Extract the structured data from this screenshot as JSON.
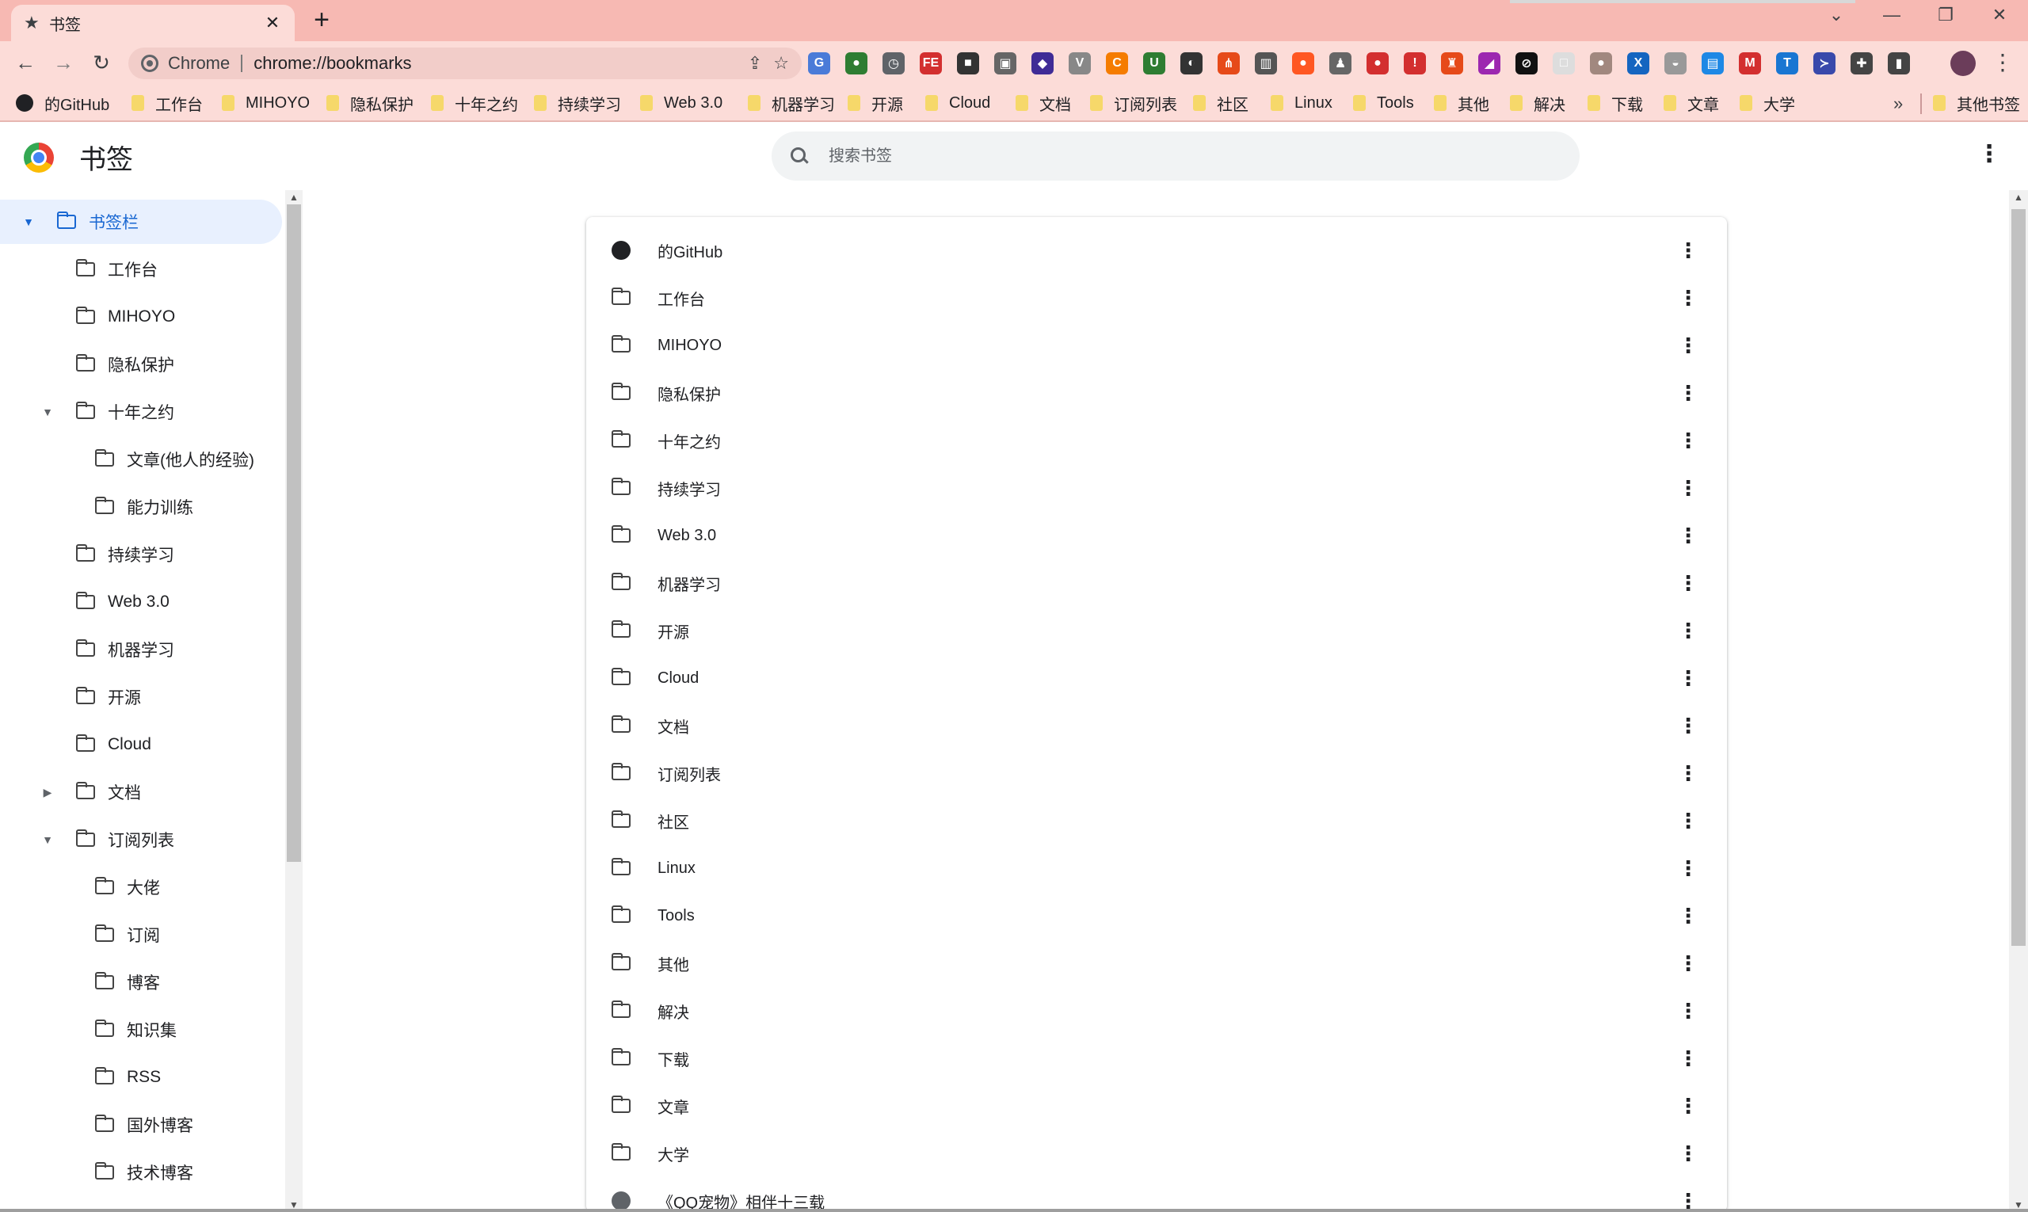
{
  "tab": {
    "title": "书签"
  },
  "omnibox": {
    "chrome_label": "Chrome",
    "url": "chrome://bookmarks"
  },
  "extensions": [
    {
      "name": "translate-ext-icon",
      "glyph": "G",
      "color": "#4a7bd8"
    },
    {
      "name": "globe-ext-icon",
      "glyph": "●",
      "color": "#2e7d32"
    },
    {
      "name": "clock-ext-icon",
      "glyph": "◷",
      "color": "#5f6368"
    },
    {
      "name": "fe-ext-icon",
      "glyph": "FE",
      "color": "#d32f2f"
    },
    {
      "name": "cube-ext-icon",
      "glyph": "■",
      "color": "#333333"
    },
    {
      "name": "gamepad-ext-icon",
      "glyph": "▣",
      "color": "#666666"
    },
    {
      "name": "diamond-ext-icon",
      "glyph": "◆",
      "color": "#3f2b96"
    },
    {
      "name": "vue-ext-icon",
      "glyph": "V",
      "color": "#888888"
    },
    {
      "name": "orange-ext-icon",
      "glyph": "C",
      "color": "#f57c00"
    },
    {
      "name": "ublock-ext-icon",
      "glyph": "U",
      "color": "#2e7d32"
    },
    {
      "name": "dark-ext-icon",
      "glyph": "◐",
      "color": "#333333"
    },
    {
      "name": "tree-ext-icon",
      "glyph": "⋔",
      "color": "#e64a19"
    },
    {
      "name": "museum-ext-icon",
      "glyph": "▥",
      "color": "#555555"
    },
    {
      "name": "fox-ext-icon",
      "glyph": "●",
      "color": "#ff5722"
    },
    {
      "name": "ghost-ext-icon",
      "glyph": "♟",
      "color": "#666666"
    },
    {
      "name": "record-ext-icon",
      "glyph": "●",
      "color": "#d32f2f"
    },
    {
      "name": "alert-ext-icon",
      "glyph": "!",
      "color": "#d32f2f"
    },
    {
      "name": "lock-ext-icon",
      "glyph": "♜",
      "color": "#e64a19"
    },
    {
      "name": "gradient-ext-icon",
      "glyph": "◢",
      "color": "#9c27b0"
    },
    {
      "name": "block-ext-icon",
      "glyph": "⊘",
      "color": "#111111"
    },
    {
      "name": "blank-ext-icon",
      "glyph": "□",
      "color": "#dddddd"
    },
    {
      "name": "cookie-ext-icon",
      "glyph": "●",
      "color": "#a1887f"
    },
    {
      "name": "x-ext-icon",
      "glyph": "X",
      "color": "#1565c0"
    },
    {
      "name": "shield-ext-icon",
      "glyph": "◒",
      "color": "#999999"
    },
    {
      "name": "doc-ext-icon",
      "glyph": "▤",
      "color": "#1e88e5"
    },
    {
      "name": "m-ext-icon",
      "glyph": "M",
      "color": "#d32f2f"
    },
    {
      "name": "t-ext-icon",
      "glyph": "T",
      "color": "#1976d2"
    },
    {
      "name": "code-ext-icon",
      "glyph": "≻",
      "color": "#3949ab"
    },
    {
      "name": "puzzle-ext-icon",
      "glyph": "✚",
      "color": "#444444"
    },
    {
      "name": "sidepanel-ext-icon",
      "glyph": "▮",
      "color": "#444444"
    }
  ],
  "bookmarks_bar": {
    "items": [
      "的GitHub",
      "工作台",
      "MIHOYO",
      "隐私保护",
      "十年之约",
      "持续学习",
      "Web 3.0",
      "机器学习",
      "开源",
      "Cloud",
      "文档",
      "订阅列表",
      "社区",
      "Linux",
      "Tools",
      "其他",
      "解决",
      "下载",
      "文章",
      "大学"
    ],
    "more": "»",
    "other_bookmarks": "其他书签"
  },
  "header": {
    "title": "书签",
    "search_placeholder": "搜索书签"
  },
  "sidebar": {
    "items": [
      {
        "label": "书签栏",
        "level": 0,
        "expanded": true,
        "selected": true
      },
      {
        "label": "工作台",
        "level": 1
      },
      {
        "label": "MIHOYO",
        "level": 1
      },
      {
        "label": "隐私保护",
        "level": 1
      },
      {
        "label": "十年之约",
        "level": 1,
        "expanded": true
      },
      {
        "label": "文章(他人的经验)",
        "level": 2
      },
      {
        "label": "能力训练",
        "level": 2
      },
      {
        "label": "持续学习",
        "level": 1
      },
      {
        "label": "Web 3.0",
        "level": 1
      },
      {
        "label": "机器学习",
        "level": 1
      },
      {
        "label": "开源",
        "level": 1
      },
      {
        "label": "Cloud",
        "level": 1
      },
      {
        "label": "文档",
        "level": 1,
        "collapsed": true
      },
      {
        "label": "订阅列表",
        "level": 1,
        "expanded": true
      },
      {
        "label": "大佬",
        "level": 2
      },
      {
        "label": "订阅",
        "level": 2
      },
      {
        "label": "博客",
        "level": 2
      },
      {
        "label": "知识集",
        "level": 2
      },
      {
        "label": "RSS",
        "level": 2
      },
      {
        "label": "国外博客",
        "level": 2
      },
      {
        "label": "技术博客",
        "level": 2
      }
    ]
  },
  "main": {
    "items": [
      {
        "label": "的GitHub",
        "icon": "github-icon"
      },
      {
        "label": "工作台",
        "icon": "folder-icon"
      },
      {
        "label": "MIHOYO",
        "icon": "folder-icon"
      },
      {
        "label": "隐私保护",
        "icon": "folder-icon"
      },
      {
        "label": "十年之约",
        "icon": "folder-icon"
      },
      {
        "label": "持续学习",
        "icon": "folder-icon"
      },
      {
        "label": "Web 3.0",
        "icon": "folder-icon"
      },
      {
        "label": "机器学习",
        "icon": "folder-icon"
      },
      {
        "label": "开源",
        "icon": "folder-icon"
      },
      {
        "label": "Cloud",
        "icon": "folder-icon"
      },
      {
        "label": "文档",
        "icon": "folder-icon"
      },
      {
        "label": "订阅列表",
        "icon": "folder-icon"
      },
      {
        "label": "社区",
        "icon": "folder-icon"
      },
      {
        "label": "Linux",
        "icon": "folder-icon"
      },
      {
        "label": "Tools",
        "icon": "folder-icon"
      },
      {
        "label": "其他",
        "icon": "folder-icon"
      },
      {
        "label": "解决",
        "icon": "folder-icon"
      },
      {
        "label": "下载",
        "icon": "folder-icon"
      },
      {
        "label": "文章",
        "icon": "folder-icon"
      },
      {
        "label": "大学",
        "icon": "folder-icon"
      },
      {
        "label": "《QQ宠物》相伴十三载",
        "icon": "globe-icon"
      }
    ]
  }
}
